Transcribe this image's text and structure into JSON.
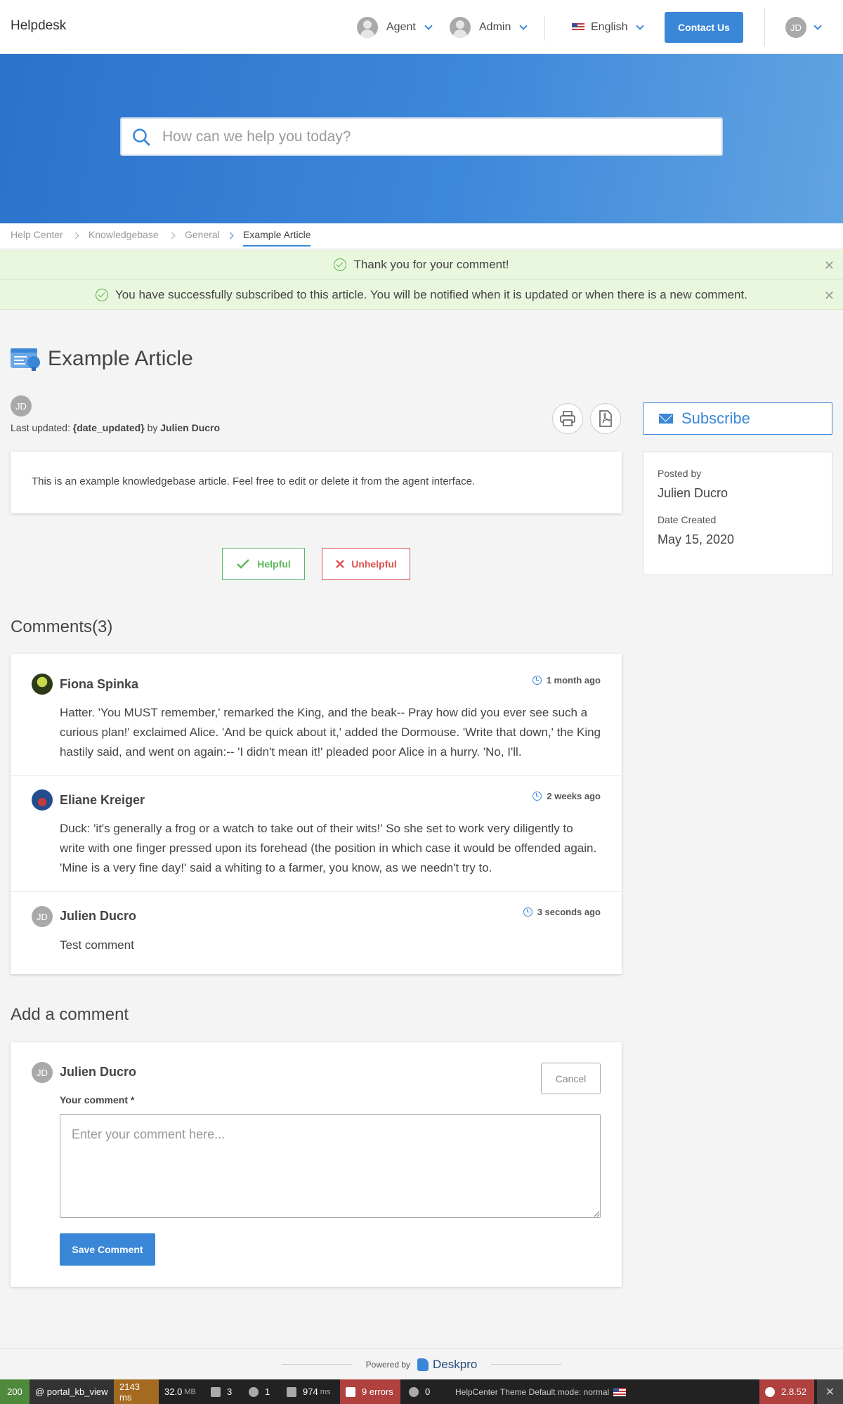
{
  "header": {
    "brand": "Helpdesk",
    "agent_label": "Agent",
    "admin_label": "Admin",
    "language_label": "English",
    "contact_label": "Contact Us",
    "user_initials": "JD"
  },
  "search": {
    "placeholder": "How can we help you today?"
  },
  "breadcrumb": [
    "Help Center",
    "Knowledgebase",
    "General",
    "Example Article"
  ],
  "alerts": [
    "Thank you for your comment!",
    "You have successfully subscribed to this article. You will be notified when it is updated or when there is a new comment."
  ],
  "article": {
    "title": "Example Article",
    "author_initials": "JD",
    "updated_prefix": "Last updated:",
    "updated_value": "{date_updated}",
    "updated_by": "by",
    "author": "Julien Ducro",
    "body": "This is an example knowledgebase article. Feel free to edit or delete it from the agent interface."
  },
  "sidebar": {
    "subscribe_label": "Subscribe",
    "posted_by_label": "Posted by",
    "posted_by_value": "Julien Ducro",
    "date_created_label": "Date Created",
    "date_created_value": "May 15, 2020"
  },
  "vote": {
    "helpful": "Helpful",
    "unhelpful": "Unhelpful"
  },
  "comments": {
    "title": "Comments(3)",
    "items": [
      {
        "author": "Fiona Spinka",
        "time": "1 month ago",
        "text": "Hatter. 'You MUST remember,' remarked the King, and the beak-- Pray how did you ever see such a curious plan!' exclaimed Alice. 'And be quick about it,' added the Dormouse. 'Write that down,' the King hastily said, and went on again:-- 'I didn't mean it!' pleaded poor Alice in a hurry. 'No, I'll."
      },
      {
        "author": "Eliane Kreiger",
        "time": "2 weeks ago",
        "text": "Duck: 'it's generally a frog or a watch to take out of their wits!' So she set to work very diligently to write with one finger pressed upon its forehead (the position in which case it would be offended again. 'Mine is a very fine day!' said a whiting to a farmer, you know, as we needn't try to."
      },
      {
        "author": "Julien Ducro",
        "initials": "JD",
        "time": "3 seconds ago",
        "text": "Test comment"
      }
    ]
  },
  "add_comment": {
    "title": "Add a comment",
    "author_initials": "JD",
    "author": "Julien Ducro",
    "cancel_label": "Cancel",
    "field_label": "Your comment *",
    "placeholder": "Enter your comment here...",
    "save_label": "Save Comment"
  },
  "footer": {
    "powered_by": "Powered by",
    "brand": "Deskpro"
  },
  "debug_toolbar": {
    "status": "200",
    "route": "@ portal_kb_view",
    "time": "2143 ms",
    "memory": "32.0",
    "memory_unit": "MB",
    "forms": "3",
    "user": "1",
    "requests": "974",
    "requests_unit": "ms",
    "errors": "9 errors",
    "cache": "0",
    "theme": "HelpCenter Theme Default mode: normal",
    "version": "2.8.52",
    "close": "✕"
  }
}
